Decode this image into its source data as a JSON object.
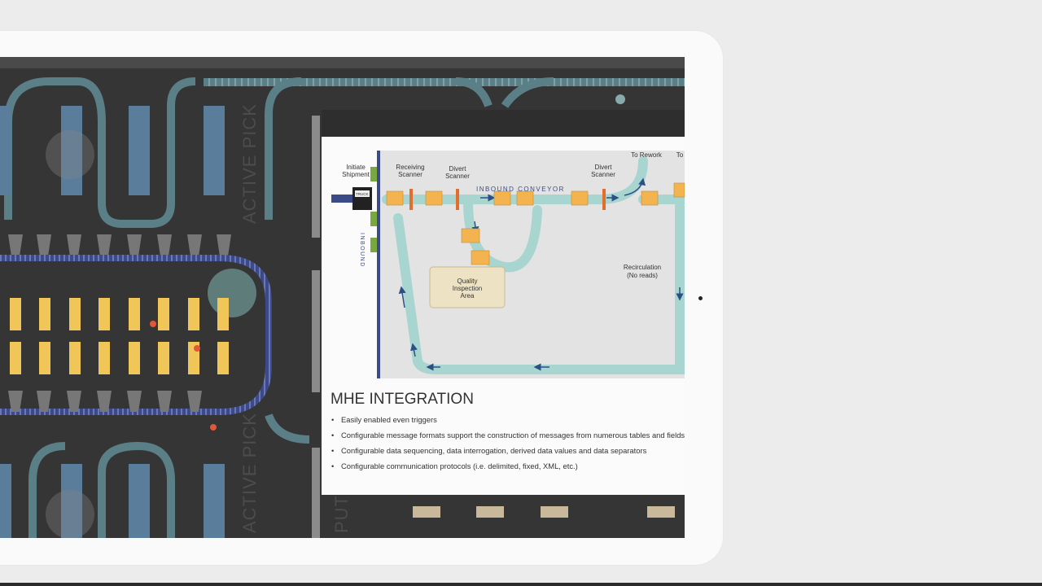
{
  "background": {
    "floor_labels": [
      "ACTIVE PICK",
      "ACTIVE PICK",
      "PUT W"
    ]
  },
  "diagram": {
    "truck_label": "TRUCK",
    "inbound_label": "INBOUND",
    "initiate_shipment": [
      "Initiate",
      "Shipment"
    ],
    "receiving_scanner": [
      "Receiving",
      "Scanner"
    ],
    "divert_scanner_1": [
      "Divert",
      "Scanner"
    ],
    "divert_scanner_2": [
      "Divert",
      "Scanner"
    ],
    "inbound_conveyor": "INBOUND CONVEYOR",
    "to_rework": "To Rework",
    "to_cut": "To",
    "quality_inspection": [
      "Quality",
      "Inspection",
      "Area"
    ],
    "recirculation": [
      "Recirculation",
      "(No reads)"
    ]
  },
  "info": {
    "title": "MHE INTEGRATION",
    "bullets": [
      "Easily enabled even triggers",
      "Configurable message formats support the construction of messages from numerous tables and fields",
      "Configurable data sequencing, data interrogation, derived data values and data separators",
      "Configurable communication protocols (i.e. delimited, fixed, XML, etc.)"
    ]
  },
  "colors": {
    "floor": "#353535",
    "conveyor": "#5b7f86",
    "shelf_yellow": "#f0c659",
    "diagram_conveyor": "#a8d5cf",
    "box": "#f3b450",
    "scanner": "#e36d2b",
    "qa_area": "#ede3c4",
    "arrow": "#2c4f86"
  }
}
